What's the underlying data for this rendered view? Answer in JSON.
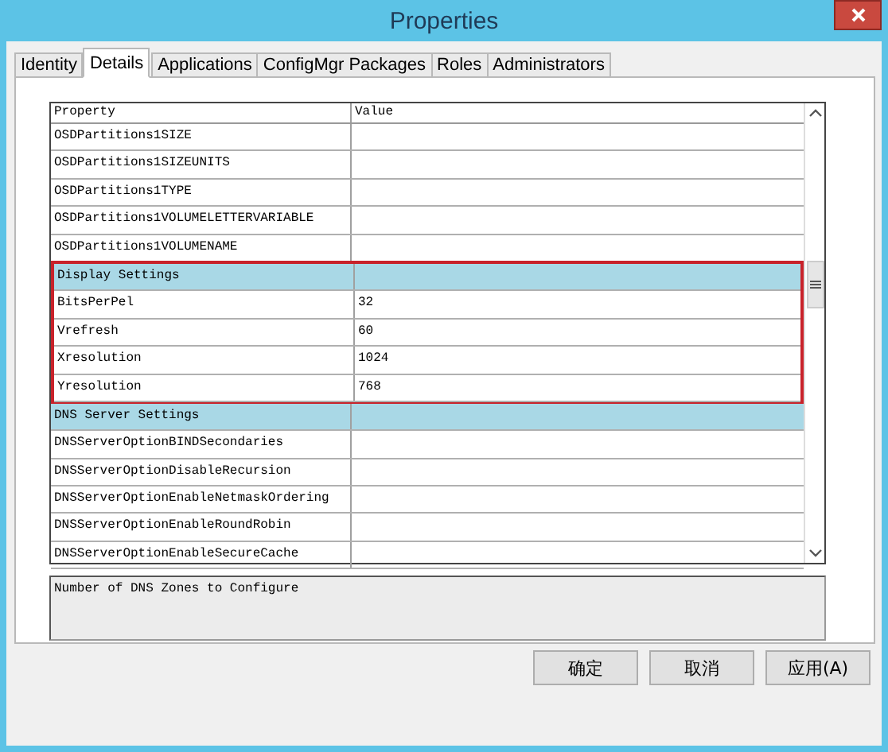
{
  "window": {
    "title": "Properties"
  },
  "tabs": [
    {
      "label": "Identity",
      "selected": false
    },
    {
      "label": "Details",
      "selected": true
    },
    {
      "label": "Applications",
      "selected": false
    },
    {
      "label": "ConfigMgr Packages",
      "selected": false
    },
    {
      "label": "Roles",
      "selected": false
    },
    {
      "label": "Administrators",
      "selected": false
    }
  ],
  "table": {
    "columns": [
      "Property",
      "Value"
    ],
    "rows": [
      {
        "kind": "item",
        "property": "OSDPartitions1SIZE",
        "value": "",
        "highlighted": false
      },
      {
        "kind": "item",
        "property": "OSDPartitions1SIZEUNITS",
        "value": "",
        "highlighted": false
      },
      {
        "kind": "item",
        "property": "OSDPartitions1TYPE",
        "value": "",
        "highlighted": false
      },
      {
        "kind": "item",
        "property": "OSDPartitions1VOLUMELETTERVARIABLE",
        "value": "",
        "highlighted": false
      },
      {
        "kind": "item",
        "property": "OSDPartitions1VOLUMENAME",
        "value": "",
        "highlighted": false
      },
      {
        "kind": "group",
        "property": "Display Settings",
        "value": "",
        "highlighted": true
      },
      {
        "kind": "item",
        "property": "BitsPerPel",
        "value": "32",
        "highlighted": true
      },
      {
        "kind": "item",
        "property": "Vrefresh",
        "value": "60",
        "highlighted": true
      },
      {
        "kind": "item",
        "property": "Xresolution",
        "value": "1024",
        "highlighted": true
      },
      {
        "kind": "item",
        "property": "Yresolution",
        "value": "768",
        "highlighted": true
      },
      {
        "kind": "group",
        "property": "DNS Server Settings",
        "value": "",
        "highlighted": false
      },
      {
        "kind": "item",
        "property": "DNSServerOptionBINDSecondaries",
        "value": "",
        "highlighted": false
      },
      {
        "kind": "item",
        "property": "DNSServerOptionDisableRecursion",
        "value": "",
        "highlighted": false
      },
      {
        "kind": "item",
        "property": "DNSServerOptionEnableNetmaskOrdering",
        "value": "",
        "highlighted": false
      },
      {
        "kind": "item",
        "property": "DNSServerOptionEnableRoundRobin",
        "value": "",
        "highlighted": false
      },
      {
        "kind": "item",
        "property": "DNSServerOptionEnableSecureCache",
        "value": "",
        "highlighted": false
      }
    ]
  },
  "description": "Number of DNS Zones to Configure",
  "buttons": [
    "确定",
    "取消",
    "应用(A)"
  ]
}
